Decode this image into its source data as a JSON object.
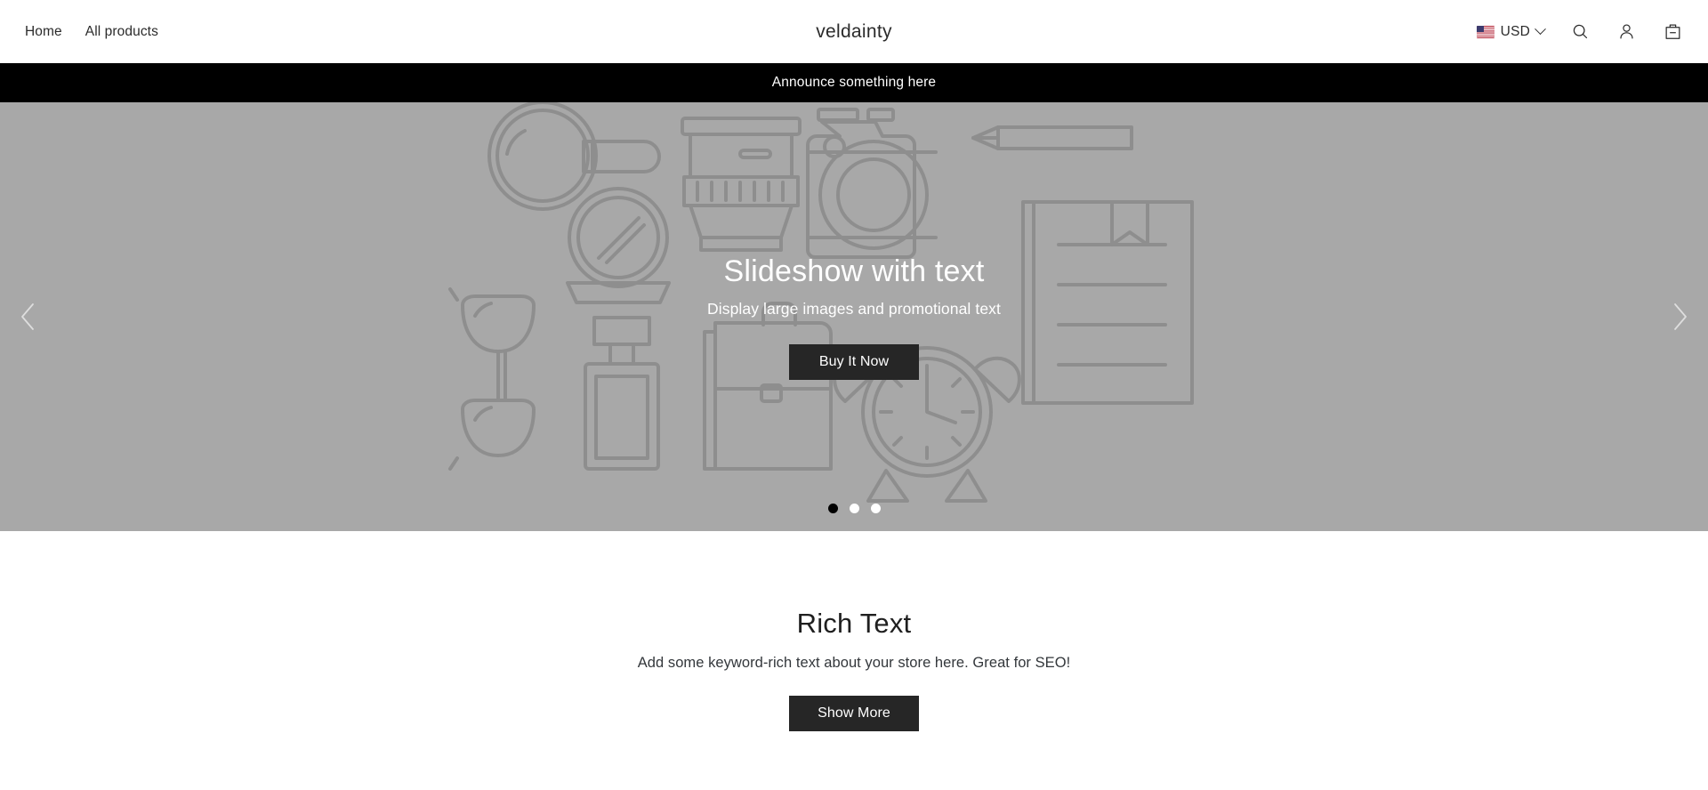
{
  "header": {
    "nav_links": [
      {
        "label": "Home"
      },
      {
        "label": "All products"
      }
    ],
    "store_name": "veldainty",
    "currency": {
      "code": "USD",
      "flag_icon": "us-flag-icon",
      "chevron_icon": "chevron-down-icon"
    },
    "icons": {
      "search": "search-icon",
      "account": "account-icon",
      "cart": "shopping-bag-icon"
    }
  },
  "announcement": {
    "text": "Announce something here"
  },
  "hero": {
    "title": "Slideshow with text",
    "subtitle": "Display large images and promotional text",
    "cta_label": "Buy It Now",
    "prev_icon": "chevron-left-icon",
    "next_icon": "chevron-right-icon",
    "slide_count": 3,
    "active_slide": 1,
    "background_color": "#a8a8a8",
    "illustration": "product-placeholder-illustration"
  },
  "rich_text": {
    "title": "Rich Text",
    "body": "Add some keyword-rich text about your store here. Great for SEO!",
    "cta_label": "Show More"
  },
  "colors": {
    "accent_dark": "#262626",
    "announcement_bg": "#000000",
    "hero_bg": "#a8a8a8",
    "page_bg": "#ffffff",
    "text_primary": "#2b2b2b"
  }
}
